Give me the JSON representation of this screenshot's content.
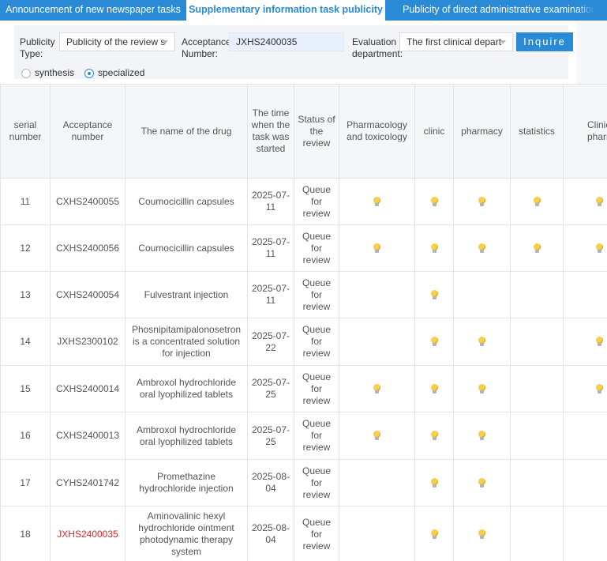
{
  "tabs": [
    {
      "label": "Announcement of new newspaper tasks"
    },
    {
      "label": "Supplementary information task publicity"
    },
    {
      "label": "Publicity of direct administrative examination and a"
    }
  ],
  "filters": {
    "publicity_type_label": "Publicity Type:",
    "publicity_type_value": "Publicity of the review s",
    "acceptance_number_label": "Acceptance Number:",
    "acceptance_number_value": "JXHS2400035",
    "evaluation_department_label": "Evaluation department:",
    "evaluation_department_value": "The first clinical depart",
    "inquire_label": "Inquire",
    "radio_synthesis": "synthesis",
    "radio_specialized": "specialized",
    "radio_selected": "specialized"
  },
  "table": {
    "headers": {
      "serial": "serial number",
      "acceptance": "Acceptance number",
      "drug": "The name of the drug",
      "time": "The time when the task was started",
      "status": "Status of the review",
      "pharmacology": "Pharmacology and toxicology",
      "clinic": "clinic",
      "pharmacy": "pharmacy",
      "statistics": "statistics",
      "clinical_pharmacology": "Clinical pharmacology"
    },
    "rows": [
      {
        "serial": "11",
        "acceptance": "CXHS2400055",
        "drug": "Coumocicillin capsules",
        "time": "2025-07-11",
        "status": "Queue for review",
        "pharmacology": true,
        "clinic": true,
        "pharmacy": true,
        "statistics": true,
        "clinical_pharmacology": true,
        "highlight": false
      },
      {
        "serial": "12",
        "acceptance": "CXHS2400056",
        "drug": "Coumocicillin capsules",
        "time": "2025-07-11",
        "status": "Queue for review",
        "pharmacology": true,
        "clinic": true,
        "pharmacy": true,
        "statistics": true,
        "clinical_pharmacology": true,
        "highlight": false
      },
      {
        "serial": "13",
        "acceptance": "CXHS2400054",
        "drug": "Fulvestrant injection",
        "time": "2025-07-11",
        "status": "Queue for review",
        "pharmacology": false,
        "clinic": true,
        "pharmacy": false,
        "statistics": false,
        "clinical_pharmacology": false,
        "highlight": false
      },
      {
        "serial": "14",
        "acceptance": "JXHS2300102",
        "drug": "Phosnipitamipalonosetron is a concentrated solution for injection",
        "time": "2025-07-22",
        "status": "Queue for review",
        "pharmacology": false,
        "clinic": true,
        "pharmacy": true,
        "statistics": false,
        "clinical_pharmacology": true,
        "highlight": false
      },
      {
        "serial": "15",
        "acceptance": "CXHS2400014",
        "drug": "Ambroxol hydrochloride oral lyophilized tablets",
        "time": "2025-07-25",
        "status": "Queue for review",
        "pharmacology": true,
        "clinic": true,
        "pharmacy": true,
        "statistics": false,
        "clinical_pharmacology": true,
        "highlight": false
      },
      {
        "serial": "16",
        "acceptance": "CXHS2400013",
        "drug": "Ambroxol hydrochloride oral lyophilized tablets",
        "time": "2025-07-25",
        "status": "Queue for review",
        "pharmacology": true,
        "clinic": true,
        "pharmacy": true,
        "statistics": false,
        "clinical_pharmacology": false,
        "highlight": false
      },
      {
        "serial": "17",
        "acceptance": "CYHS2401742",
        "drug": "Promethazine hydrochloride injection",
        "time": "2025-08-04",
        "status": "Queue for review",
        "pharmacology": false,
        "clinic": true,
        "pharmacy": true,
        "statistics": false,
        "clinical_pharmacology": false,
        "highlight": false
      },
      {
        "serial": "18",
        "acceptance": "JXHS2400035",
        "drug": "Aminovalinic hexyl hydrochloride ointment photodynamic therapy system",
        "time": "2025-08-04",
        "status": "Queue for review",
        "pharmacology": false,
        "clinic": true,
        "pharmacy": true,
        "statistics": false,
        "clinical_pharmacology": false,
        "highlight": true
      }
    ]
  },
  "colors": {
    "primary": "#2b8ad6",
    "highlight_text": "#d9262c",
    "bulb": "#f6cf4d"
  },
  "icons": {
    "review_indicator": "lightbulb-icon",
    "select_caret": "chevron-down-icon"
  }
}
